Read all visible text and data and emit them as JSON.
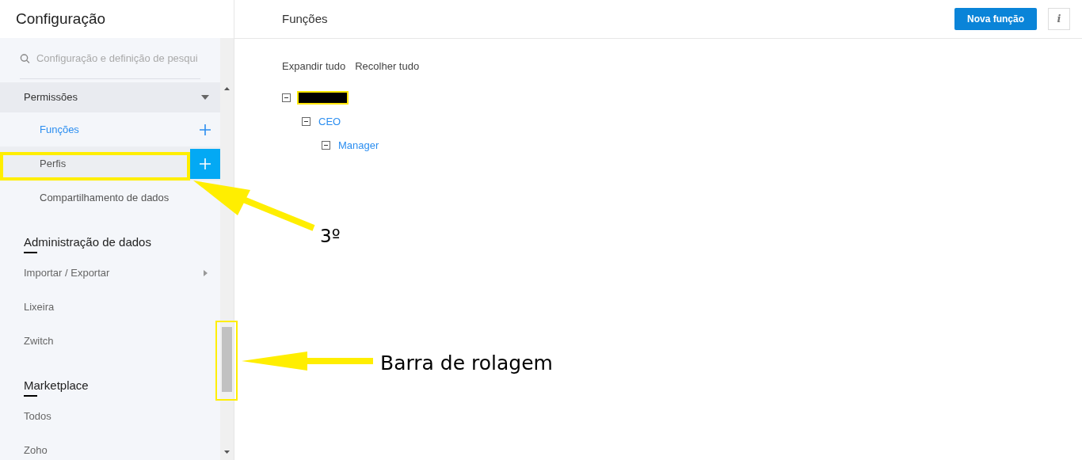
{
  "sidebar": {
    "title": "Configuração",
    "search": {
      "placeholder": "Configuração e definição de pesqui"
    },
    "items": [
      {
        "kind": "group",
        "label": "Permissões",
        "expanded": true,
        "children": [
          {
            "label": "Funções",
            "selected": true,
            "hovered": false
          },
          {
            "label": "Perfis",
            "selected": false,
            "hovered": true
          },
          {
            "label": "Compartilhamento de dados",
            "selected": false,
            "hovered": false
          }
        ]
      },
      {
        "kind": "heading",
        "label": "Administração de dados"
      },
      {
        "kind": "link",
        "label": "Importar / Exportar",
        "submenu": true
      },
      {
        "kind": "link",
        "label": "Lixeira"
      },
      {
        "kind": "link",
        "label": "Zwitch"
      },
      {
        "kind": "heading",
        "label": "Marketplace"
      },
      {
        "kind": "link",
        "label": "Todos"
      },
      {
        "kind": "link",
        "label": "Zoho"
      }
    ]
  },
  "main": {
    "title": "Funções",
    "primary_button": "Nova função",
    "info_button": "i",
    "toolbar": [
      "Expandir tudo",
      "Recolher tudo"
    ],
    "tree": [
      {
        "redacted": true,
        "expanded": true,
        "children": [
          {
            "label": "CEO",
            "expanded": true,
            "children": [
              {
                "label": "Manager",
                "expanded": true
              }
            ]
          }
        ]
      }
    ]
  },
  "annotations": [
    {
      "label": "3º"
    },
    {
      "label": "Barra de rolagem"
    }
  ]
}
